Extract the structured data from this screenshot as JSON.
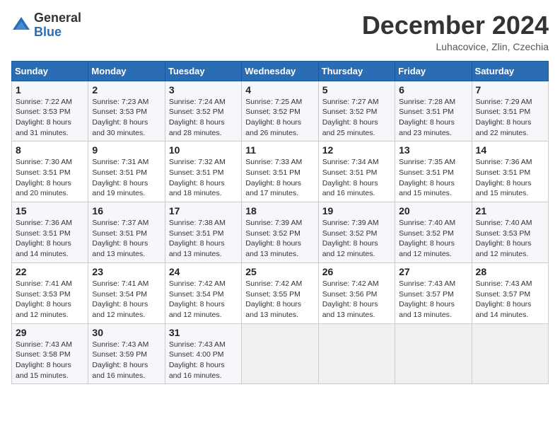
{
  "logo": {
    "general": "General",
    "blue": "Blue"
  },
  "header": {
    "title": "December 2024",
    "subtitle": "Luhacovice, Zlin, Czechia"
  },
  "days_of_week": [
    "Sunday",
    "Monday",
    "Tuesday",
    "Wednesday",
    "Thursday",
    "Friday",
    "Saturday"
  ],
  "weeks": [
    [
      {
        "num": "1",
        "sunrise": "Sunrise: 7:22 AM",
        "sunset": "Sunset: 3:53 PM",
        "daylight": "Daylight: 8 hours and 31 minutes."
      },
      {
        "num": "2",
        "sunrise": "Sunrise: 7:23 AM",
        "sunset": "Sunset: 3:53 PM",
        "daylight": "Daylight: 8 hours and 30 minutes."
      },
      {
        "num": "3",
        "sunrise": "Sunrise: 7:24 AM",
        "sunset": "Sunset: 3:52 PM",
        "daylight": "Daylight: 8 hours and 28 minutes."
      },
      {
        "num": "4",
        "sunrise": "Sunrise: 7:25 AM",
        "sunset": "Sunset: 3:52 PM",
        "daylight": "Daylight: 8 hours and 26 minutes."
      },
      {
        "num": "5",
        "sunrise": "Sunrise: 7:27 AM",
        "sunset": "Sunset: 3:52 PM",
        "daylight": "Daylight: 8 hours and 25 minutes."
      },
      {
        "num": "6",
        "sunrise": "Sunrise: 7:28 AM",
        "sunset": "Sunset: 3:51 PM",
        "daylight": "Daylight: 8 hours and 23 minutes."
      },
      {
        "num": "7",
        "sunrise": "Sunrise: 7:29 AM",
        "sunset": "Sunset: 3:51 PM",
        "daylight": "Daylight: 8 hours and 22 minutes."
      }
    ],
    [
      {
        "num": "8",
        "sunrise": "Sunrise: 7:30 AM",
        "sunset": "Sunset: 3:51 PM",
        "daylight": "Daylight: 8 hours and 20 minutes."
      },
      {
        "num": "9",
        "sunrise": "Sunrise: 7:31 AM",
        "sunset": "Sunset: 3:51 PM",
        "daylight": "Daylight: 8 hours and 19 minutes."
      },
      {
        "num": "10",
        "sunrise": "Sunrise: 7:32 AM",
        "sunset": "Sunset: 3:51 PM",
        "daylight": "Daylight: 8 hours and 18 minutes."
      },
      {
        "num": "11",
        "sunrise": "Sunrise: 7:33 AM",
        "sunset": "Sunset: 3:51 PM",
        "daylight": "Daylight: 8 hours and 17 minutes."
      },
      {
        "num": "12",
        "sunrise": "Sunrise: 7:34 AM",
        "sunset": "Sunset: 3:51 PM",
        "daylight": "Daylight: 8 hours and 16 minutes."
      },
      {
        "num": "13",
        "sunrise": "Sunrise: 7:35 AM",
        "sunset": "Sunset: 3:51 PM",
        "daylight": "Daylight: 8 hours and 15 minutes."
      },
      {
        "num": "14",
        "sunrise": "Sunrise: 7:36 AM",
        "sunset": "Sunset: 3:51 PM",
        "daylight": "Daylight: 8 hours and 15 minutes."
      }
    ],
    [
      {
        "num": "15",
        "sunrise": "Sunrise: 7:36 AM",
        "sunset": "Sunset: 3:51 PM",
        "daylight": "Daylight: 8 hours and 14 minutes."
      },
      {
        "num": "16",
        "sunrise": "Sunrise: 7:37 AM",
        "sunset": "Sunset: 3:51 PM",
        "daylight": "Daylight: 8 hours and 13 minutes."
      },
      {
        "num": "17",
        "sunrise": "Sunrise: 7:38 AM",
        "sunset": "Sunset: 3:51 PM",
        "daylight": "Daylight: 8 hours and 13 minutes."
      },
      {
        "num": "18",
        "sunrise": "Sunrise: 7:39 AM",
        "sunset": "Sunset: 3:52 PM",
        "daylight": "Daylight: 8 hours and 13 minutes."
      },
      {
        "num": "19",
        "sunrise": "Sunrise: 7:39 AM",
        "sunset": "Sunset: 3:52 PM",
        "daylight": "Daylight: 8 hours and 12 minutes."
      },
      {
        "num": "20",
        "sunrise": "Sunrise: 7:40 AM",
        "sunset": "Sunset: 3:52 PM",
        "daylight": "Daylight: 8 hours and 12 minutes."
      },
      {
        "num": "21",
        "sunrise": "Sunrise: 7:40 AM",
        "sunset": "Sunset: 3:53 PM",
        "daylight": "Daylight: 8 hours and 12 minutes."
      }
    ],
    [
      {
        "num": "22",
        "sunrise": "Sunrise: 7:41 AM",
        "sunset": "Sunset: 3:53 PM",
        "daylight": "Daylight: 8 hours and 12 minutes."
      },
      {
        "num": "23",
        "sunrise": "Sunrise: 7:41 AM",
        "sunset": "Sunset: 3:54 PM",
        "daylight": "Daylight: 8 hours and 12 minutes."
      },
      {
        "num": "24",
        "sunrise": "Sunrise: 7:42 AM",
        "sunset": "Sunset: 3:54 PM",
        "daylight": "Daylight: 8 hours and 12 minutes."
      },
      {
        "num": "25",
        "sunrise": "Sunrise: 7:42 AM",
        "sunset": "Sunset: 3:55 PM",
        "daylight": "Daylight: 8 hours and 13 minutes."
      },
      {
        "num": "26",
        "sunrise": "Sunrise: 7:42 AM",
        "sunset": "Sunset: 3:56 PM",
        "daylight": "Daylight: 8 hours and 13 minutes."
      },
      {
        "num": "27",
        "sunrise": "Sunrise: 7:43 AM",
        "sunset": "Sunset: 3:57 PM",
        "daylight": "Daylight: 8 hours and 13 minutes."
      },
      {
        "num": "28",
        "sunrise": "Sunrise: 7:43 AM",
        "sunset": "Sunset: 3:57 PM",
        "daylight": "Daylight: 8 hours and 14 minutes."
      }
    ],
    [
      {
        "num": "29",
        "sunrise": "Sunrise: 7:43 AM",
        "sunset": "Sunset: 3:58 PM",
        "daylight": "Daylight: 8 hours and 15 minutes."
      },
      {
        "num": "30",
        "sunrise": "Sunrise: 7:43 AM",
        "sunset": "Sunset: 3:59 PM",
        "daylight": "Daylight: 8 hours and 16 minutes."
      },
      {
        "num": "31",
        "sunrise": "Sunrise: 7:43 AM",
        "sunset": "Sunset: 4:00 PM",
        "daylight": "Daylight: 8 hours and 16 minutes."
      },
      null,
      null,
      null,
      null
    ]
  ]
}
